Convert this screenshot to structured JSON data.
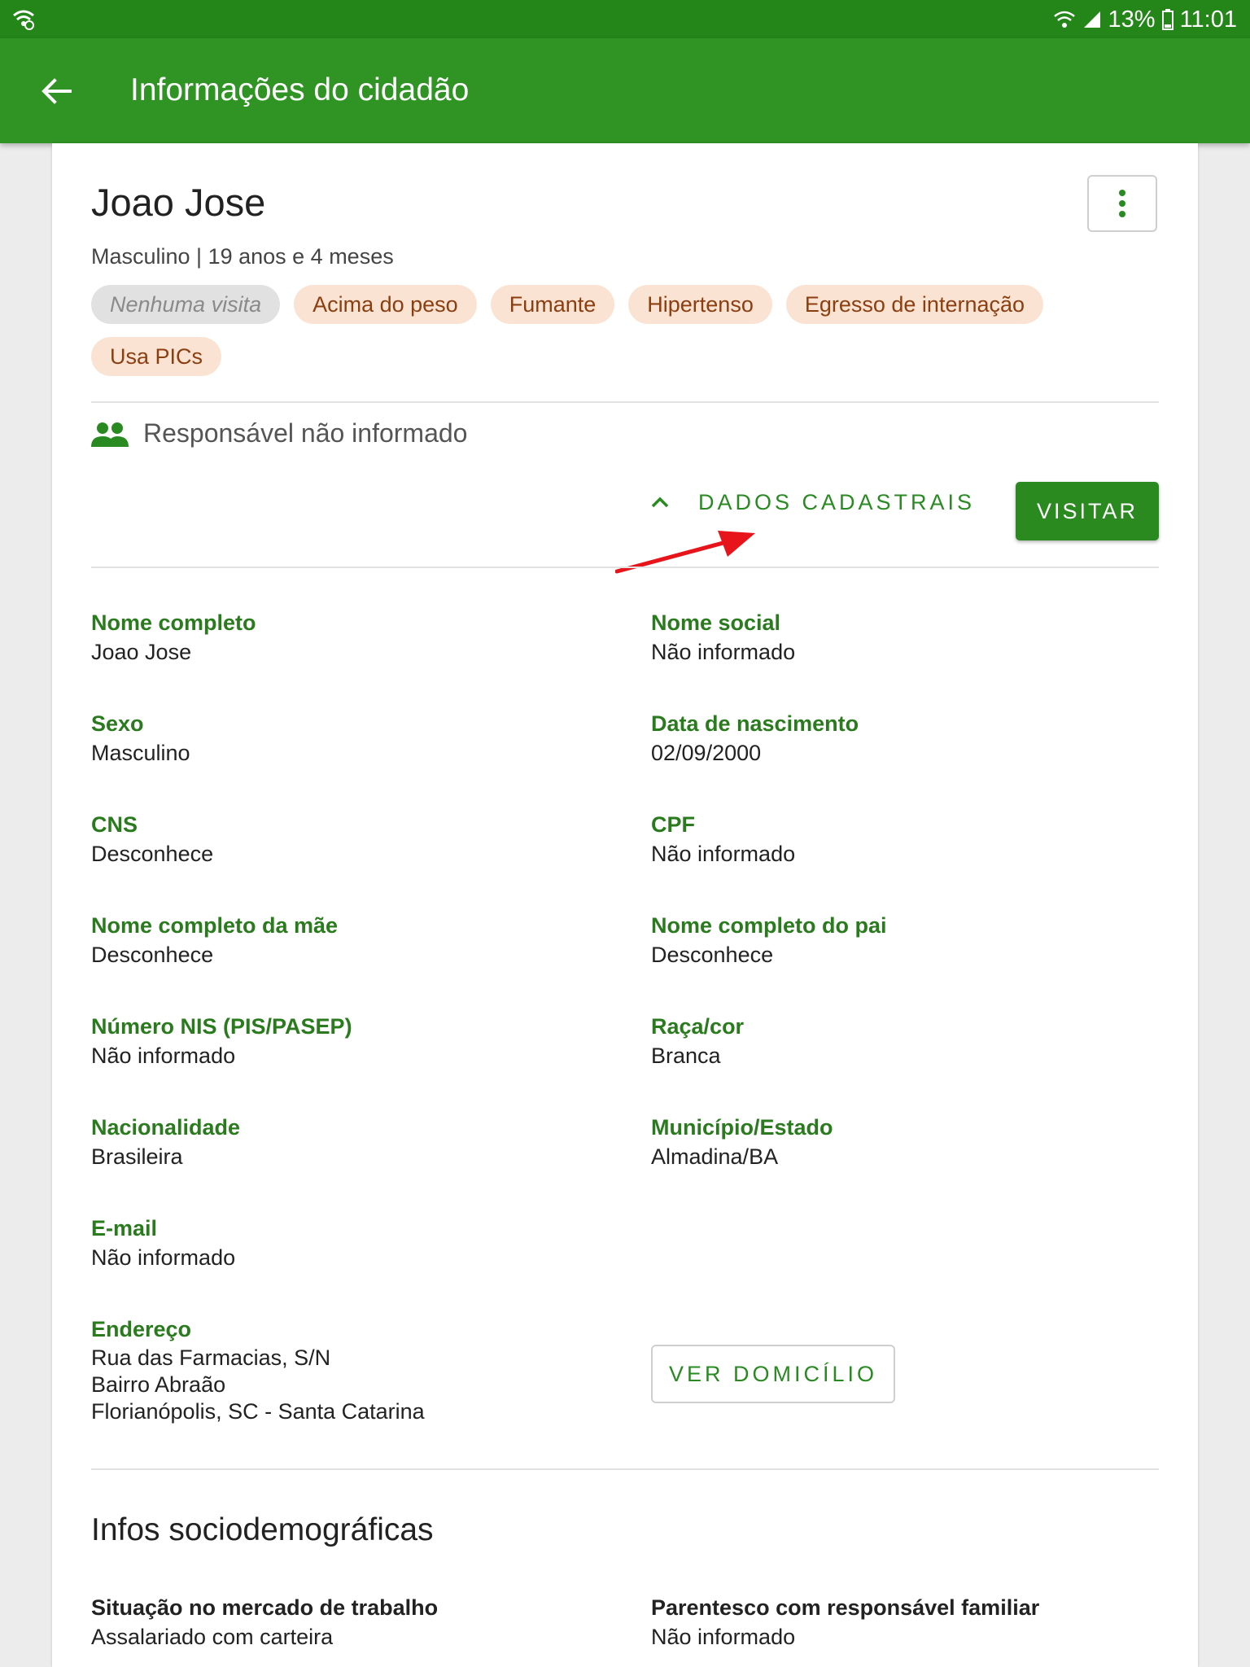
{
  "status_bar": {
    "battery": "13%",
    "time": "11:01"
  },
  "app_bar": {
    "title": "Informações do cidadão"
  },
  "citizen": {
    "name": "Joao Jose",
    "subinfo": "Masculino | 19 anos e 4 meses",
    "tags": [
      "Nenhuma visita",
      "Acima do peso",
      "Fumante",
      "Hipertenso",
      "Egresso de internação",
      "Usa PICs"
    ],
    "responsible": "Responsável não informado"
  },
  "actions": {
    "dados_cadastrais": "DADOS CADASTRAIS",
    "visitar": "VISITAR",
    "ver_domicilio": "VER DOMICÍLIO"
  },
  "fields": {
    "nome_completo": {
      "label": "Nome completo",
      "value": "Joao Jose"
    },
    "nome_social": {
      "label": "Nome social",
      "value": "Não informado"
    },
    "sexo": {
      "label": "Sexo",
      "value": "Masculino"
    },
    "data_nascimento": {
      "label": "Data de nascimento",
      "value": "02/09/2000"
    },
    "cns": {
      "label": "CNS",
      "value": "Desconhece"
    },
    "cpf": {
      "label": "CPF",
      "value": "Não informado"
    },
    "mae": {
      "label": "Nome completo da mãe",
      "value": "Desconhece"
    },
    "pai": {
      "label": "Nome completo do pai",
      "value": "Desconhece"
    },
    "nis": {
      "label": "Número NIS (PIS/PASEP)",
      "value": "Não informado"
    },
    "raca": {
      "label": "Raça/cor",
      "value": "Branca"
    },
    "nacionalidade": {
      "label": "Nacionalidade",
      "value": "Brasileira"
    },
    "municipio": {
      "label": "Município/Estado",
      "value": "Almadina/BA"
    },
    "email": {
      "label": "E-mail",
      "value": "Não informado"
    },
    "endereco": {
      "label": "Endereço",
      "lines": [
        "Rua das Farmacias, S/N",
        "Bairro Abraão",
        "Florianópolis, SC - Santa Catarina"
      ]
    }
  },
  "socio": {
    "title": "Infos sociodemográficas",
    "trabalho": {
      "label": "Situação no mercado de trabalho",
      "value": "Assalariado com carteira"
    },
    "parentesco": {
      "label": "Parentesco com responsável familiar",
      "value": "Não informado"
    }
  },
  "colors": {
    "primary": "#2f9424",
    "label_green": "#2a7a1e",
    "chip_bg": "#fbe3d3",
    "chip_text": "#8b3f10",
    "annotation_arrow": "#e8141b"
  }
}
